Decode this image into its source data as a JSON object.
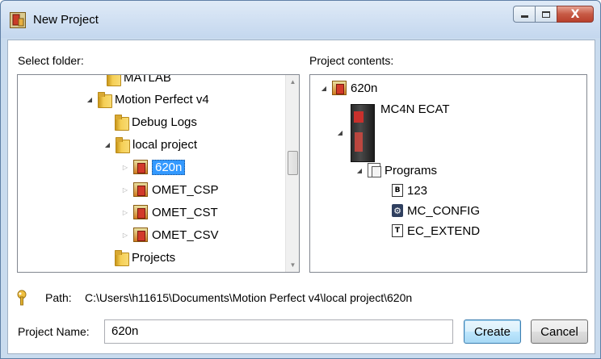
{
  "window": {
    "title": "New Project",
    "buttons": {
      "minimize": "minimize",
      "maximize": "maximize",
      "close": "X"
    }
  },
  "folder_panel": {
    "label": "Select folder:",
    "items": [
      {
        "label": "MATLAB",
        "level": 1,
        "expander": "none",
        "icon": "folder-icon"
      },
      {
        "label": "Motion Perfect v4",
        "level": 1,
        "expander": "open",
        "icon": "folder-icon"
      },
      {
        "label": "Debug Logs",
        "level": 2,
        "expander": "none",
        "icon": "folder-icon"
      },
      {
        "label": "local project",
        "level": 2,
        "expander": "open",
        "icon": "folder-icon"
      },
      {
        "label": "620n",
        "level": 3,
        "expander": "closed",
        "icon": "project-icon",
        "selected": true
      },
      {
        "label": "OMET_CSP",
        "level": 3,
        "expander": "closed",
        "icon": "project-icon"
      },
      {
        "label": "OMET_CST",
        "level": 3,
        "expander": "closed",
        "icon": "project-icon"
      },
      {
        "label": "OMET_CSV",
        "level": 3,
        "expander": "closed",
        "icon": "project-icon"
      },
      {
        "label": "Projects",
        "level": 2,
        "expander": "none",
        "icon": "folder-icon"
      }
    ]
  },
  "contents_panel": {
    "label": "Project contents:",
    "project": "620n",
    "controller": "MC4N ECAT",
    "programs_label": "Programs",
    "programs": [
      {
        "label": "123",
        "icon": "basic-file-icon",
        "glyph": "B"
      },
      {
        "label": "MC_CONFIG",
        "icon": "config-file-icon",
        "glyph": "⚙"
      },
      {
        "label": "EC_EXTEND",
        "icon": "text-file-icon",
        "glyph": "T"
      }
    ]
  },
  "path": {
    "label": "Path:",
    "value": "C:\\Users\\h11615\\Documents\\Motion Perfect v4\\local project\\620n"
  },
  "project_name": {
    "label": "Project Name:",
    "value": "620n"
  },
  "actions": {
    "create": "Create",
    "cancel": "Cancel"
  }
}
